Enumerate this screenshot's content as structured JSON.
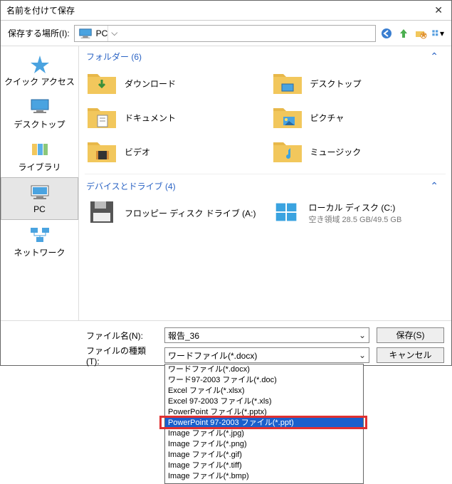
{
  "window": {
    "title": "名前を付けて保存"
  },
  "toolbar": {
    "location_label": "保存する場所(I):",
    "location_value": "PC"
  },
  "sidebar": {
    "items": [
      {
        "label": "クイック アクセス",
        "icon": "star-icon"
      },
      {
        "label": "デスクトップ",
        "icon": "desktop-icon"
      },
      {
        "label": "ライブラリ",
        "icon": "libraries-icon"
      },
      {
        "label": "PC",
        "icon": "pc-icon",
        "selected": true
      },
      {
        "label": "ネットワーク",
        "icon": "network-icon"
      }
    ]
  },
  "main": {
    "folders_header": "フォルダー (6)",
    "devices_header": "デバイスとドライブ (4)",
    "folders": [
      {
        "label": "ダウンロード",
        "icon": "downloads-folder-icon"
      },
      {
        "label": "デスクトップ",
        "icon": "desktop-folder-icon"
      },
      {
        "label": "ドキュメント",
        "icon": "documents-folder-icon"
      },
      {
        "label": "ピクチャ",
        "icon": "pictures-folder-icon"
      },
      {
        "label": "ビデオ",
        "icon": "videos-folder-icon"
      },
      {
        "label": "ミュージック",
        "icon": "music-folder-icon"
      }
    ],
    "drives": [
      {
        "label": "フロッピー ディスク ドライブ (A:)",
        "icon": "floppy-icon"
      },
      {
        "label": "ローカル ディスク (C:)",
        "sub": "空き領域 28.5 GB/49.5 GB",
        "icon": "windows-drive-icon"
      }
    ]
  },
  "bottom": {
    "filename_label": "ファイル名(N):",
    "filename_value": "報告_36",
    "filetype_label": "ファイルの種類(T):",
    "filetype_value": "ワードファイル(*.docx)",
    "save_label": "保存(S)",
    "cancel_label": "キャンセル"
  },
  "dropdown": {
    "options": [
      "ワードファイル(*.docx)",
      "ワード97-2003 ファイル(*.doc)",
      "Excel ファイル(*.xlsx)",
      "Excel 97-2003 ファイル(*.xls)",
      "PowerPoint ファイル(*.pptx)",
      "PowerPoint 97-2003 ファイル(*.ppt)",
      "Image ファイル(*.jpg)",
      "Image ファイル(*.png)",
      "Image ファイル(*.gif)",
      "Image ファイル(*.tiff)",
      "Image ファイル(*.bmp)"
    ],
    "selected_index": 5
  }
}
